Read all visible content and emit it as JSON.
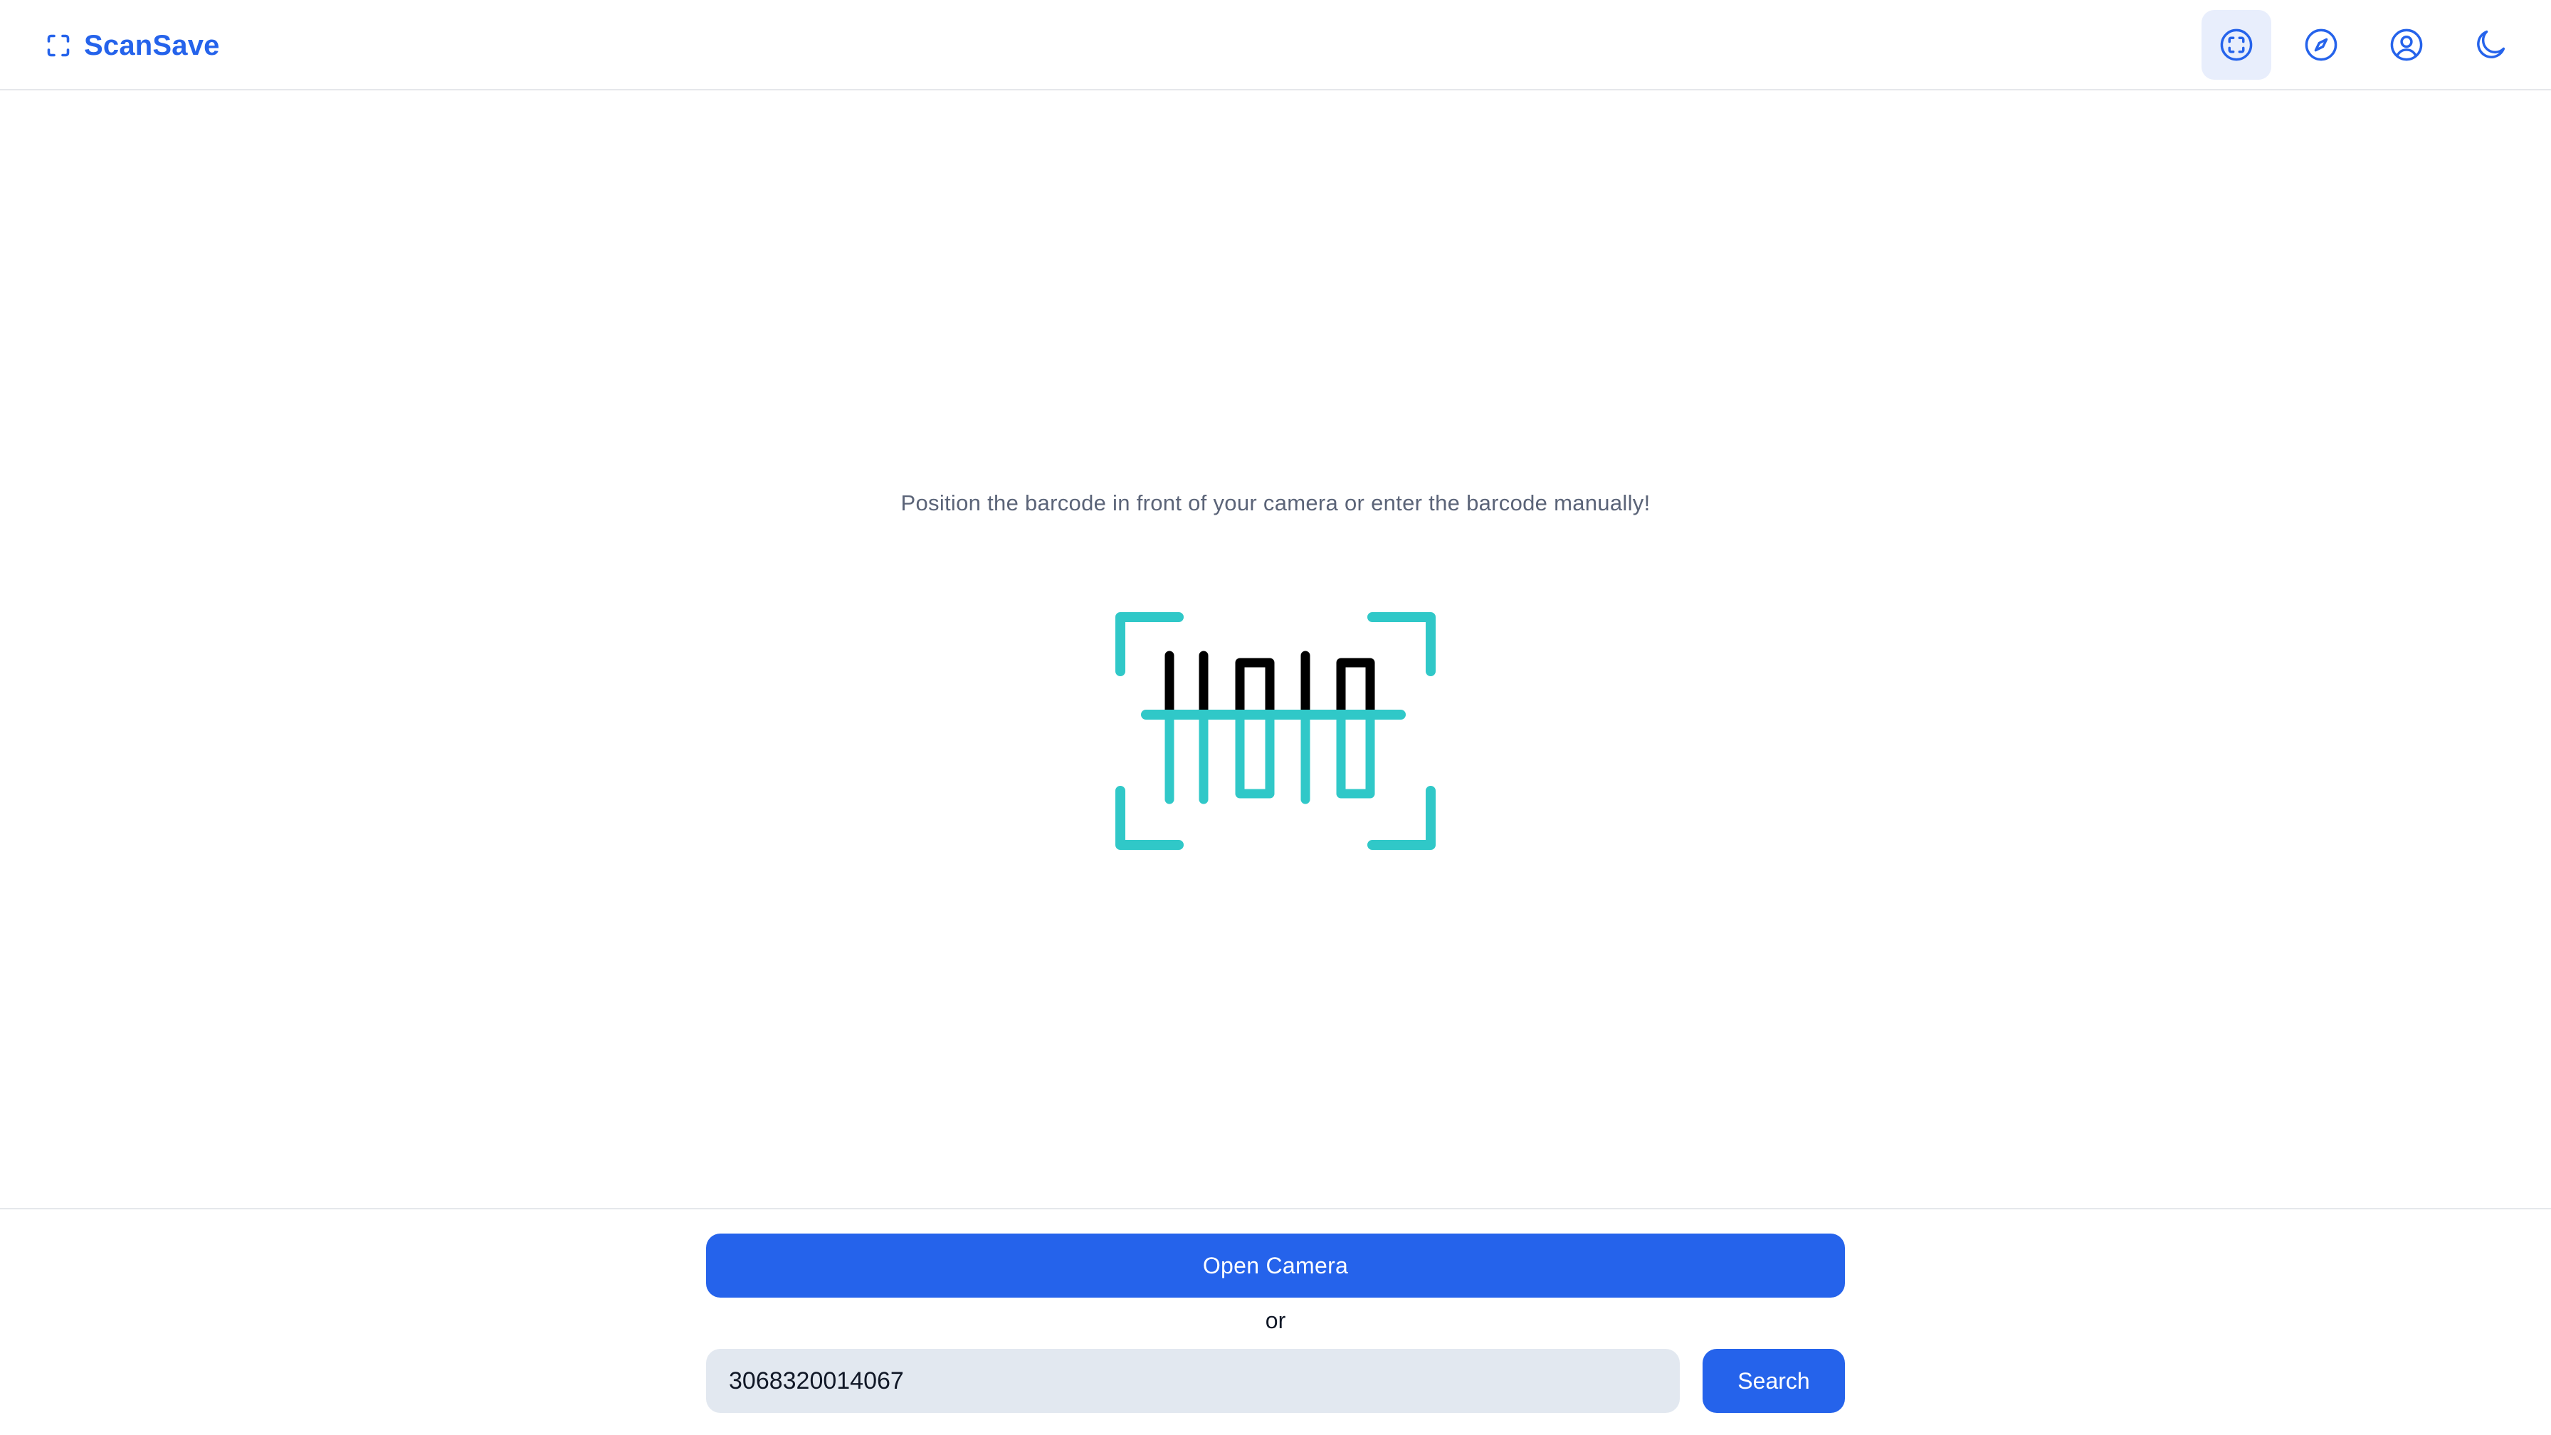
{
  "app": {
    "name": "ScanSave",
    "logo_icon": "scan-frame-icon"
  },
  "nav": {
    "items": [
      {
        "icon": "scan-icon",
        "active": true
      },
      {
        "icon": "compass-icon",
        "active": false
      },
      {
        "icon": "user-circle-icon",
        "active": false
      },
      {
        "icon": "moon-icon",
        "active": false
      }
    ]
  },
  "main": {
    "instruction": "Position the barcode in front of your camera or enter the barcode manually!",
    "illustration_icon": "barcode-scan-illustration",
    "colors": {
      "accent": "#30c8c8",
      "bars": "#000000"
    }
  },
  "footer": {
    "open_camera_label": "Open Camera",
    "separator": "or",
    "barcode_value": "3068320014067",
    "search_label": "Search"
  },
  "colors": {
    "primary": "#2563eb",
    "input_bg": "#e2e8f0",
    "muted_text": "#5b6478"
  }
}
